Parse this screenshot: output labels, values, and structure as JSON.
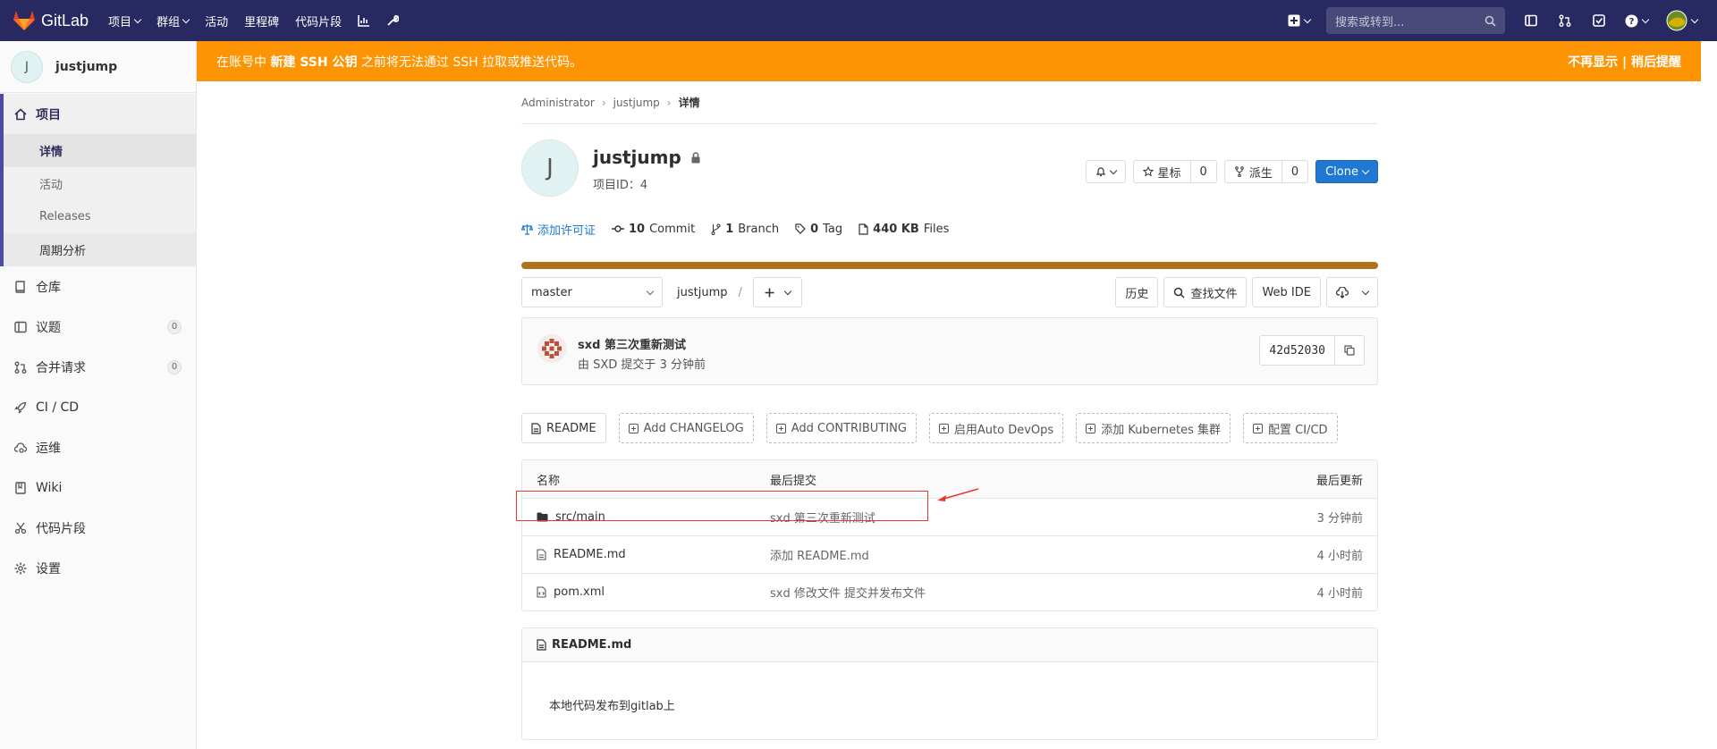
{
  "topbar": {
    "logo_text": "GitLab",
    "nav": [
      "项目",
      "群组",
      "活动",
      "里程碑",
      "代码片段"
    ],
    "search_placeholder": "搜索或转到..."
  },
  "banner": {
    "prefix": "在账号中 ",
    "bold": "新建 SSH 公钥",
    "suffix": " 之前将无法通过 SSH 拉取或推送代码。",
    "dismiss": "不再显示",
    "sep": "|",
    "later": "稍后提醒"
  },
  "sidebar": {
    "project_initial": "J",
    "project_name": "justjump",
    "section_project": "项目",
    "sub": [
      "详情",
      "活动",
      "Releases",
      "周期分析"
    ],
    "items": [
      {
        "label": "仓库"
      },
      {
        "label": "议题",
        "badge": "0"
      },
      {
        "label": "合并请求",
        "badge": "0"
      },
      {
        "label": "CI / CD"
      },
      {
        "label": "运维"
      },
      {
        "label": "Wiki"
      },
      {
        "label": "代码片段"
      },
      {
        "label": "设置"
      }
    ]
  },
  "breadcrumb": [
    "Administrator",
    "justjump",
    "详情"
  ],
  "project": {
    "initial": "J",
    "name": "justjump",
    "id_label": "项目ID：4",
    "star_label": "星标",
    "star_count": "0",
    "fork_label": "派生",
    "fork_count": "0",
    "clone_label": "Clone"
  },
  "stats": {
    "license": "添加许可证",
    "commits_n": "10",
    "commits": "Commit",
    "branch_n": "1",
    "branch": "Branch",
    "tag_n": "0",
    "tag": "Tag",
    "size_n": "440 KB",
    "files": "Files"
  },
  "toolbar": {
    "branch": "master",
    "path": "justjump",
    "path_sep": "/",
    "history": "历史",
    "find": "查找文件",
    "webide": "Web IDE"
  },
  "commit": {
    "title": "sxd 第三次重新测试",
    "sub": "由 SXD 提交于 3 分钟前",
    "sha": "42d52030"
  },
  "quick": [
    "README",
    "Add CHANGELOG",
    "Add CONTRIBUTING",
    "启用Auto DevOps",
    "添加 Kubernetes 集群",
    "配置 CI/CD"
  ],
  "files": {
    "headers": [
      "名称",
      "最后提交",
      "最后更新"
    ],
    "rows": [
      {
        "name": "src/main",
        "commit": "sxd 第三次重新测试",
        "updated": "3 分钟前"
      },
      {
        "name": "README.md",
        "commit": "添加 README.md",
        "updated": "4 小时前"
      },
      {
        "name": "pom.xml",
        "commit": "sxd 修改文件 提交并发布文件",
        "updated": "4 小时前"
      }
    ]
  },
  "readme": {
    "title": "README.md",
    "body": "本地代码发布到gitlab上"
  },
  "colors": {
    "topbar": "#292961",
    "banner": "#fc9403",
    "accent": "#1f78d1",
    "lang": "#b07219"
  }
}
